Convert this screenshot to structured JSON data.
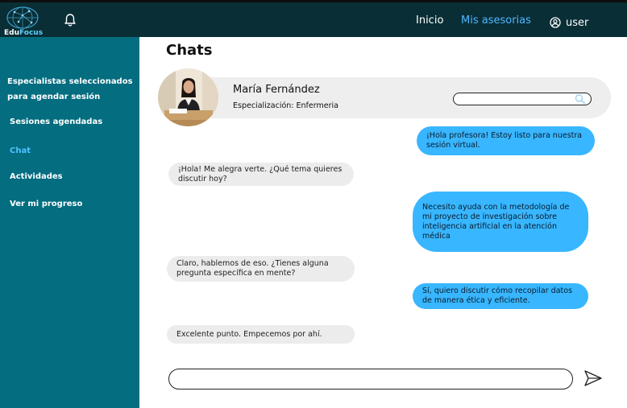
{
  "brand": {
    "part1": "Edu",
    "part2": "Focus"
  },
  "icons": {
    "logo": "brain-network-logo",
    "bell": "bell-icon",
    "user": "user-circle-icon",
    "search": "search-icon",
    "send": "send-icon"
  },
  "nav": {
    "inicio": "Inicio",
    "mis_asesorias": "Mis asesorias",
    "user": "user"
  },
  "sidebar": {
    "heading": "Especialistas seleccionados para agendar sesión",
    "items": [
      {
        "label": "Sesiones agendadas"
      },
      {
        "label": "Chat"
      },
      {
        "label": "Actividades"
      },
      {
        "label": "Ver mi progreso"
      }
    ]
  },
  "page": {
    "title": "Chats"
  },
  "contact": {
    "name": "María Fernández",
    "spec_label": "Especialización: ",
    "spec_value": "Enfermeria"
  },
  "messages": [
    {
      "from": "me",
      "text": "¡Hola profesora! Estoy listo para nuestra sesión virtual."
    },
    {
      "from": "them",
      "text": "¡Hola! Me alegra verte. ¿Qué tema quieres discutir hoy?"
    },
    {
      "from": "me",
      "text": "Necesito ayuda con la metodología de mi proyecto de investigación sobre inteligencia artificial en la atención médica"
    },
    {
      "from": "them",
      "text": "Claro, hablemos de eso. ¿Tienes alguna pregunta específica en mente?"
    },
    {
      "from": "me",
      "text": "Sí, quiero discutir cómo recopilar datos de manera ética y eficiente."
    },
    {
      "from": "them",
      "text": "Excelente punto. Empecemos por ahí."
    }
  ],
  "colors": {
    "topbar": "#0a2e36",
    "sidebar": "#046d80",
    "accent": "#38b6ff",
    "bubble_in": "#ececec"
  }
}
